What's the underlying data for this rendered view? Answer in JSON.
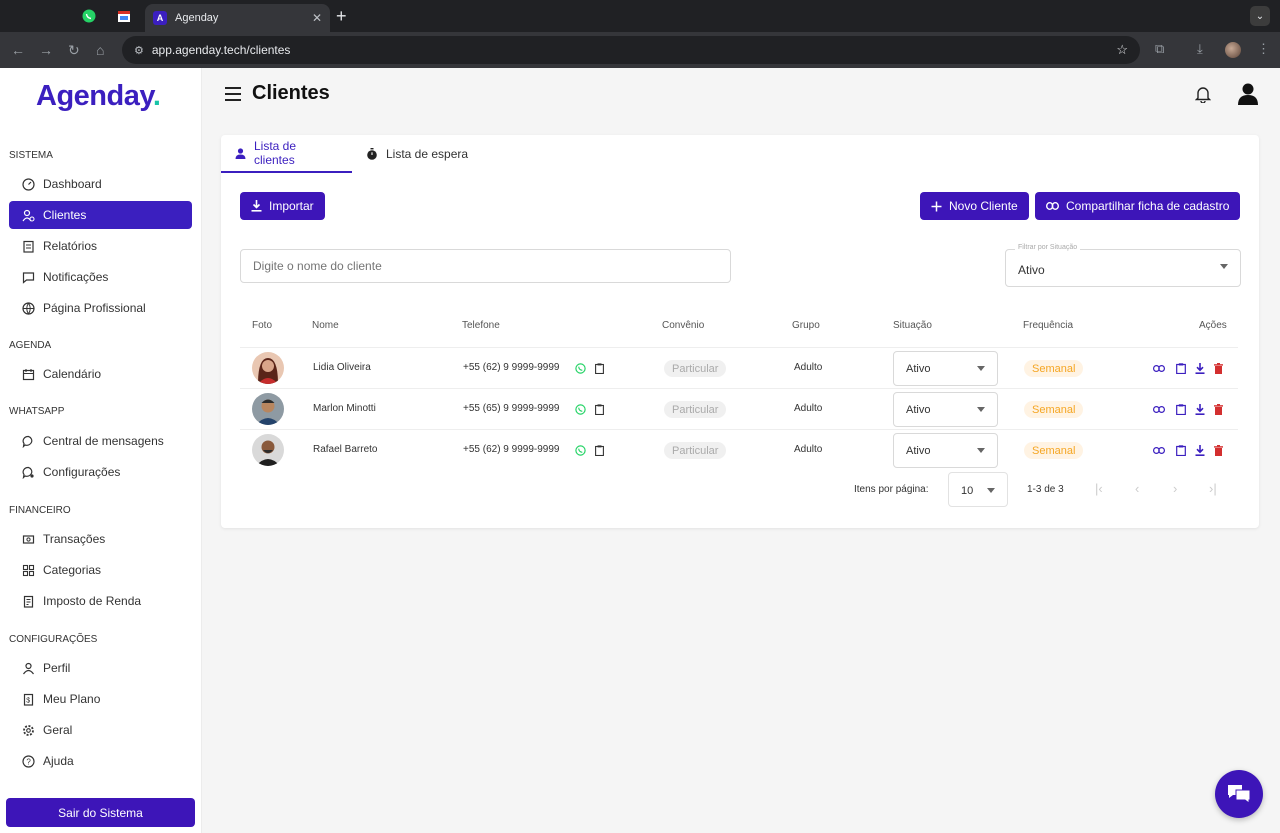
{
  "browser": {
    "tab_title": "Agenday",
    "tab_favicon": "A",
    "url": "app.agenday.tech/clientes"
  },
  "sidebar": {
    "logo_text": "Agenday",
    "logo_dot": ".",
    "sections": [
      {
        "title": "SISTEMA",
        "items": [
          {
            "label": "Dashboard",
            "icon": "dashboard-icon"
          },
          {
            "label": "Clientes",
            "icon": "clients-icon",
            "active": true
          },
          {
            "label": "Relatórios",
            "icon": "reports-icon"
          },
          {
            "label": "Notificações",
            "icon": "notifications-icon"
          },
          {
            "label": "Página Profissional",
            "icon": "web-icon"
          }
        ]
      },
      {
        "title": "AGENDA",
        "items": [
          {
            "label": "Calendário",
            "icon": "calendar-icon"
          }
        ]
      },
      {
        "title": "WHATSAPP",
        "items": [
          {
            "label": "Central de mensagens",
            "icon": "chat-icon"
          },
          {
            "label": "Configurações",
            "icon": "settings-chat-icon"
          }
        ]
      },
      {
        "title": "FINANCEIRO",
        "items": [
          {
            "label": "Transações",
            "icon": "transactions-icon"
          },
          {
            "label": "Categorias",
            "icon": "categories-icon"
          },
          {
            "label": "Imposto de Renda",
            "icon": "tax-icon"
          }
        ]
      },
      {
        "title": "CONFIGURAÇÕES",
        "items": [
          {
            "label": "Perfil",
            "icon": "profile-icon"
          },
          {
            "label": "Meu Plano",
            "icon": "plan-icon"
          },
          {
            "label": "Geral",
            "icon": "gear-icon"
          },
          {
            "label": "Ajuda",
            "icon": "help-icon"
          }
        ]
      }
    ],
    "logout_label": "Sair do Sistema"
  },
  "header": {
    "title": "Clientes"
  },
  "tabs": [
    {
      "label": "Lista de clientes",
      "active": true
    },
    {
      "label": "Lista de espera",
      "active": false
    }
  ],
  "actions": {
    "import_label": "Importar",
    "new_client_label": "Novo Cliente",
    "share_label": "Compartilhar ficha de cadastro"
  },
  "search": {
    "placeholder": "Digite o nome do cliente"
  },
  "filter": {
    "label": "Filtrar por Situação",
    "value": "Ativo"
  },
  "table": {
    "columns": [
      "Foto",
      "Nome",
      "Telefone",
      "Convênio",
      "Grupo",
      "Situação",
      "Frequência",
      "Ações"
    ],
    "rows": [
      {
        "name": "Lidia Oliveira",
        "phone": "+55 (62) 9 9999-9999",
        "insurance": "Particular",
        "group": "Adulto",
        "status": "Ativo",
        "frequency": "Semanal"
      },
      {
        "name": "Marlon Minotti",
        "phone": "+55 (65) 9 9999-9999",
        "insurance": "Particular",
        "group": "Adulto",
        "status": "Ativo",
        "frequency": "Semanal"
      },
      {
        "name": "Rafael Barreto",
        "phone": "+55 (62) 9 9999-9999",
        "insurance": "Particular",
        "group": "Adulto",
        "status": "Ativo",
        "frequency": "Semanal"
      }
    ]
  },
  "pagination": {
    "items_per_page_label": "Itens por página:",
    "items_per_page": "10",
    "range": "1-3 de 3"
  },
  "colors": {
    "brand": "#3d15b8",
    "accent_teal": "#18c4a8",
    "chip_orange": "#f5a623",
    "delete_red": "#d32f2f",
    "whatsapp_green": "#25d366"
  }
}
